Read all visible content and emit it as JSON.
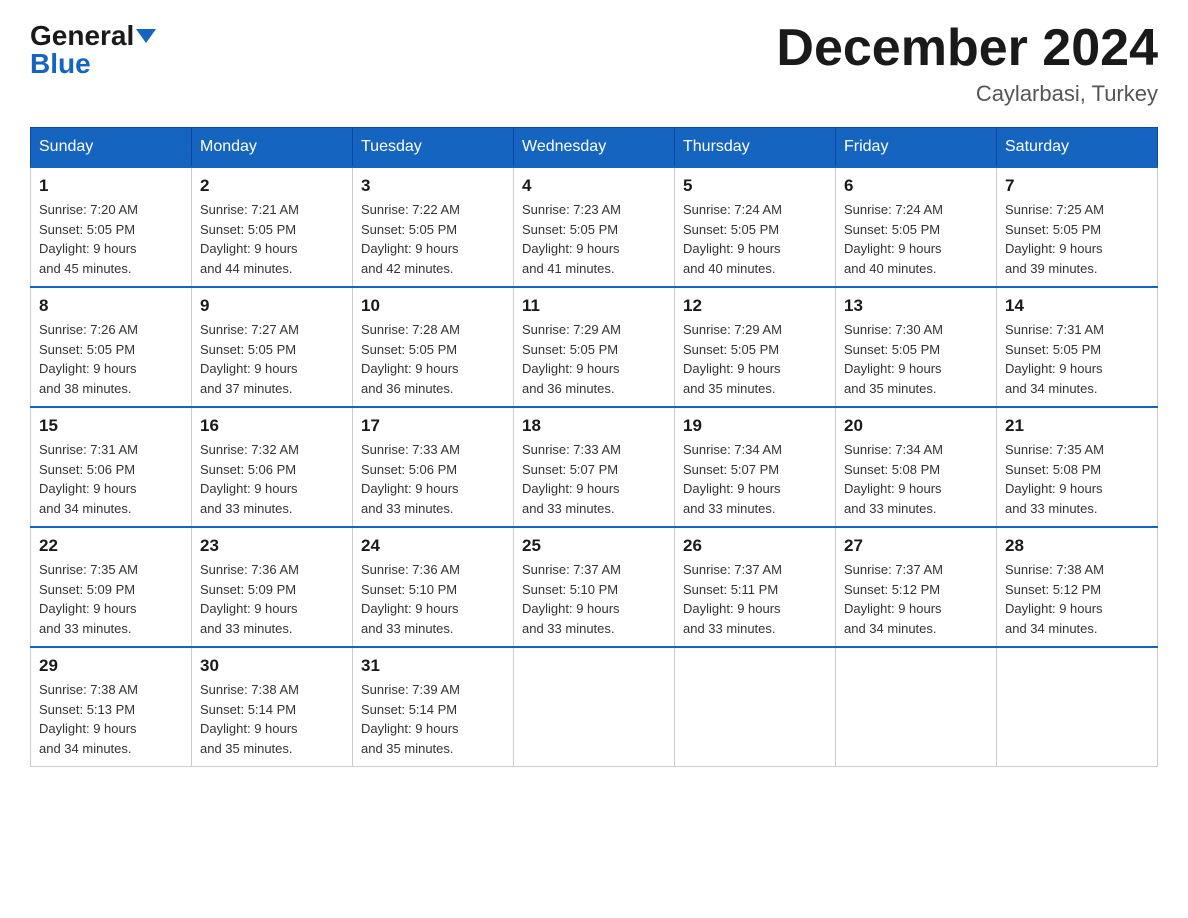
{
  "header": {
    "logo_line1": "General",
    "logo_line2": "Blue",
    "month_title": "December 2024",
    "location": "Caylarbasi, Turkey"
  },
  "days_of_week": [
    "Sunday",
    "Monday",
    "Tuesday",
    "Wednesday",
    "Thursday",
    "Friday",
    "Saturday"
  ],
  "weeks": [
    [
      {
        "day": "1",
        "sunrise": "7:20 AM",
        "sunset": "5:05 PM",
        "daylight": "9 hours and 45 minutes."
      },
      {
        "day": "2",
        "sunrise": "7:21 AM",
        "sunset": "5:05 PM",
        "daylight": "9 hours and 44 minutes."
      },
      {
        "day": "3",
        "sunrise": "7:22 AM",
        "sunset": "5:05 PM",
        "daylight": "9 hours and 42 minutes."
      },
      {
        "day": "4",
        "sunrise": "7:23 AM",
        "sunset": "5:05 PM",
        "daylight": "9 hours and 41 minutes."
      },
      {
        "day": "5",
        "sunrise": "7:24 AM",
        "sunset": "5:05 PM",
        "daylight": "9 hours and 40 minutes."
      },
      {
        "day": "6",
        "sunrise": "7:24 AM",
        "sunset": "5:05 PM",
        "daylight": "9 hours and 40 minutes."
      },
      {
        "day": "7",
        "sunrise": "7:25 AM",
        "sunset": "5:05 PM",
        "daylight": "9 hours and 39 minutes."
      }
    ],
    [
      {
        "day": "8",
        "sunrise": "7:26 AM",
        "sunset": "5:05 PM",
        "daylight": "9 hours and 38 minutes."
      },
      {
        "day": "9",
        "sunrise": "7:27 AM",
        "sunset": "5:05 PM",
        "daylight": "9 hours and 37 minutes."
      },
      {
        "day": "10",
        "sunrise": "7:28 AM",
        "sunset": "5:05 PM",
        "daylight": "9 hours and 36 minutes."
      },
      {
        "day": "11",
        "sunrise": "7:29 AM",
        "sunset": "5:05 PM",
        "daylight": "9 hours and 36 minutes."
      },
      {
        "day": "12",
        "sunrise": "7:29 AM",
        "sunset": "5:05 PM",
        "daylight": "9 hours and 35 minutes."
      },
      {
        "day": "13",
        "sunrise": "7:30 AM",
        "sunset": "5:05 PM",
        "daylight": "9 hours and 35 minutes."
      },
      {
        "day": "14",
        "sunrise": "7:31 AM",
        "sunset": "5:05 PM",
        "daylight": "9 hours and 34 minutes."
      }
    ],
    [
      {
        "day": "15",
        "sunrise": "7:31 AM",
        "sunset": "5:06 PM",
        "daylight": "9 hours and 34 minutes."
      },
      {
        "day": "16",
        "sunrise": "7:32 AM",
        "sunset": "5:06 PM",
        "daylight": "9 hours and 33 minutes."
      },
      {
        "day": "17",
        "sunrise": "7:33 AM",
        "sunset": "5:06 PM",
        "daylight": "9 hours and 33 minutes."
      },
      {
        "day": "18",
        "sunrise": "7:33 AM",
        "sunset": "5:07 PM",
        "daylight": "9 hours and 33 minutes."
      },
      {
        "day": "19",
        "sunrise": "7:34 AM",
        "sunset": "5:07 PM",
        "daylight": "9 hours and 33 minutes."
      },
      {
        "day": "20",
        "sunrise": "7:34 AM",
        "sunset": "5:08 PM",
        "daylight": "9 hours and 33 minutes."
      },
      {
        "day": "21",
        "sunrise": "7:35 AM",
        "sunset": "5:08 PM",
        "daylight": "9 hours and 33 minutes."
      }
    ],
    [
      {
        "day": "22",
        "sunrise": "7:35 AM",
        "sunset": "5:09 PM",
        "daylight": "9 hours and 33 minutes."
      },
      {
        "day": "23",
        "sunrise": "7:36 AM",
        "sunset": "5:09 PM",
        "daylight": "9 hours and 33 minutes."
      },
      {
        "day": "24",
        "sunrise": "7:36 AM",
        "sunset": "5:10 PM",
        "daylight": "9 hours and 33 minutes."
      },
      {
        "day": "25",
        "sunrise": "7:37 AM",
        "sunset": "5:10 PM",
        "daylight": "9 hours and 33 minutes."
      },
      {
        "day": "26",
        "sunrise": "7:37 AM",
        "sunset": "5:11 PM",
        "daylight": "9 hours and 33 minutes."
      },
      {
        "day": "27",
        "sunrise": "7:37 AM",
        "sunset": "5:12 PM",
        "daylight": "9 hours and 34 minutes."
      },
      {
        "day": "28",
        "sunrise": "7:38 AM",
        "sunset": "5:12 PM",
        "daylight": "9 hours and 34 minutes."
      }
    ],
    [
      {
        "day": "29",
        "sunrise": "7:38 AM",
        "sunset": "5:13 PM",
        "daylight": "9 hours and 34 minutes."
      },
      {
        "day": "30",
        "sunrise": "7:38 AM",
        "sunset": "5:14 PM",
        "daylight": "9 hours and 35 minutes."
      },
      {
        "day": "31",
        "sunrise": "7:39 AM",
        "sunset": "5:14 PM",
        "daylight": "9 hours and 35 minutes."
      },
      null,
      null,
      null,
      null
    ]
  ],
  "labels": {
    "sunrise_prefix": "Sunrise: ",
    "sunset_prefix": "Sunset: ",
    "daylight_prefix": "Daylight: "
  }
}
